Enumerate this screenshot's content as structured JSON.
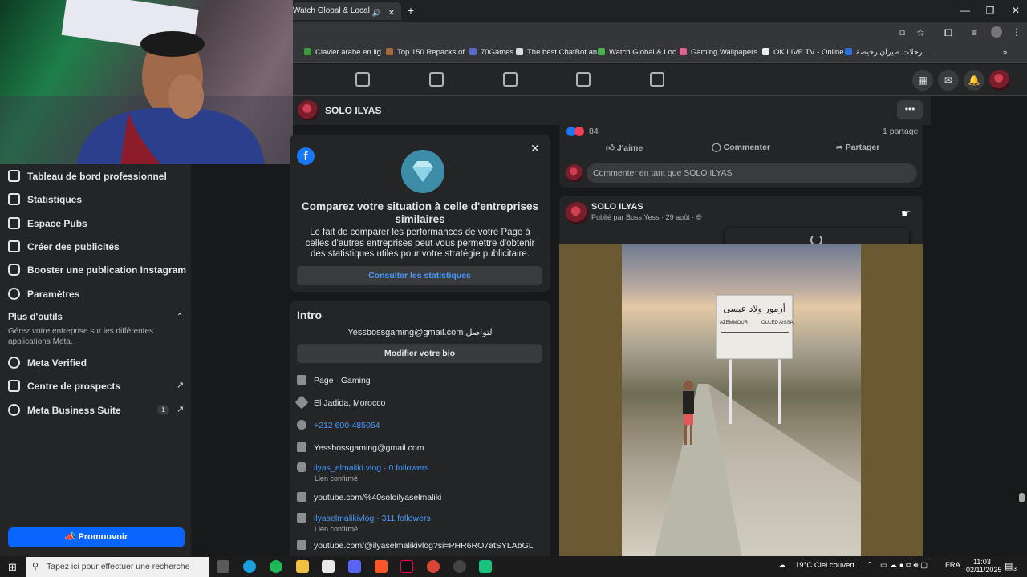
{
  "browser": {
    "tab_title": "Watch Global & Local Live",
    "bookmarks": [
      "Clavier arabe en lig...",
      "Top 150 Repacks of...",
      "70Games",
      "The best ChatBot an...",
      "Watch Global & Loc...",
      "Gaming Wallpapers...",
      "OK LIVE TV - Online...",
      "رحلات طيران رخيصة..."
    ]
  },
  "page": {
    "name": "SOLO ILYAS"
  },
  "sidebar": {
    "items": [
      "Tableau de bord professionnel",
      "Statistiques",
      "Espace Pubs",
      "Créer des publicités",
      "Booster une publication Instagram",
      "Paramètres"
    ],
    "more_tools_title": "Plus d'outils",
    "more_tools_desc": "Gérez votre entreprise sur les différentes applications Meta.",
    "tools": [
      "Meta Verified",
      "Centre de prospects",
      "Meta Business Suite"
    ],
    "business_suite_badge": "1",
    "promote_label": "Promouvoir"
  },
  "compare": {
    "title": "Comparez votre situation à celle d'entreprises similaires",
    "body": "Le fait de comparer les performances de votre Page à celles d'autres entreprises peut vous permettre d'obtenir des statistiques utiles pour votre stratégie publicitaire.",
    "button": "Consulter les statistiques"
  },
  "intro": {
    "title": "Intro",
    "bio": "Yessbossgaming@gmail.com لتواصل",
    "edit_bio": "Modifier votre bio",
    "category": "Page · Gaming",
    "location": "El Jadida, Morocco",
    "phone": "+212 600-485054",
    "email": "Yessbossgaming@gmail.com",
    "instagram": "ilyas_elmaliki.vlog · 0 followers",
    "instagram_sub": "Lien confirmé",
    "youtube_url": "youtube.com/%40soloilyaselmaliki",
    "tiktok": "ilyaselmalikivlog · 311 followers",
    "tiktok_sub": "Lien confirmé",
    "youtube_url2": "youtube.com/@ilyaselmalikivlog?si=PHR6RO7atSYLAbGL"
  },
  "post1": {
    "reactions": "84",
    "shares": "1 partage",
    "like": "J'aime",
    "comment": "Commenter",
    "share": "Partager",
    "comment_placeholder": "Commenter en tant que SOLO ILYAS"
  },
  "post2": {
    "author": "SOLO ILYAS",
    "published_by": "Publié par Boss Yess",
    "date": "29 août",
    "sign_arabic": "أزمور     ولاد عيسى",
    "sign_left": "AZEMMOUR",
    "sign_right": "OULED AISSA"
  },
  "taskbar": {
    "search_placeholder": "Tapez ici pour effectuer une recherche",
    "weather": "19°C  Ciel couvert",
    "lang": "FRA",
    "time": "11:03",
    "date": "02/11/2025",
    "notif_count": "3"
  }
}
